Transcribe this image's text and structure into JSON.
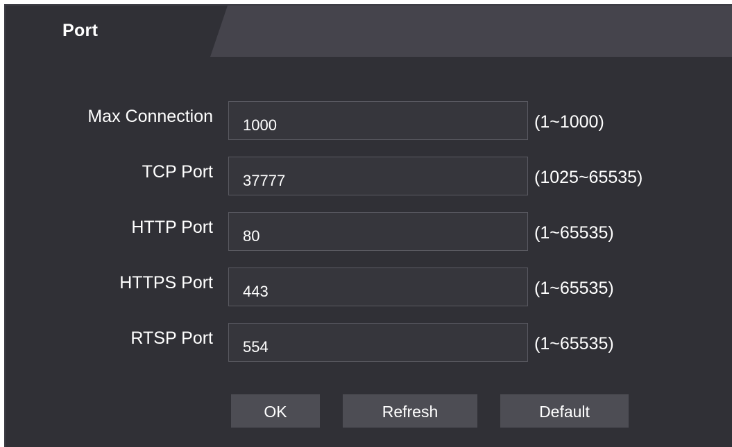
{
  "panel": {
    "title": "Port"
  },
  "fields": [
    {
      "label": "Max Connection",
      "value": "1000",
      "range": "(1~1000)"
    },
    {
      "label": "TCP Port",
      "value": "37777",
      "range": "(1025~65535)"
    },
    {
      "label": "HTTP Port",
      "value": "80",
      "range": "(1~65535)"
    },
    {
      "label": "HTTPS Port",
      "value": "443",
      "range": "(1~65535)"
    },
    {
      "label": "RTSP Port",
      "value": "554",
      "range": "(1~65535)"
    }
  ],
  "buttons": {
    "ok": "OK",
    "refresh": "Refresh",
    "default": "Default"
  },
  "colors": {
    "panel_background": "#303036",
    "header_band": "#45444c",
    "button_background": "#4d4d54",
    "text": "#ffffff"
  }
}
